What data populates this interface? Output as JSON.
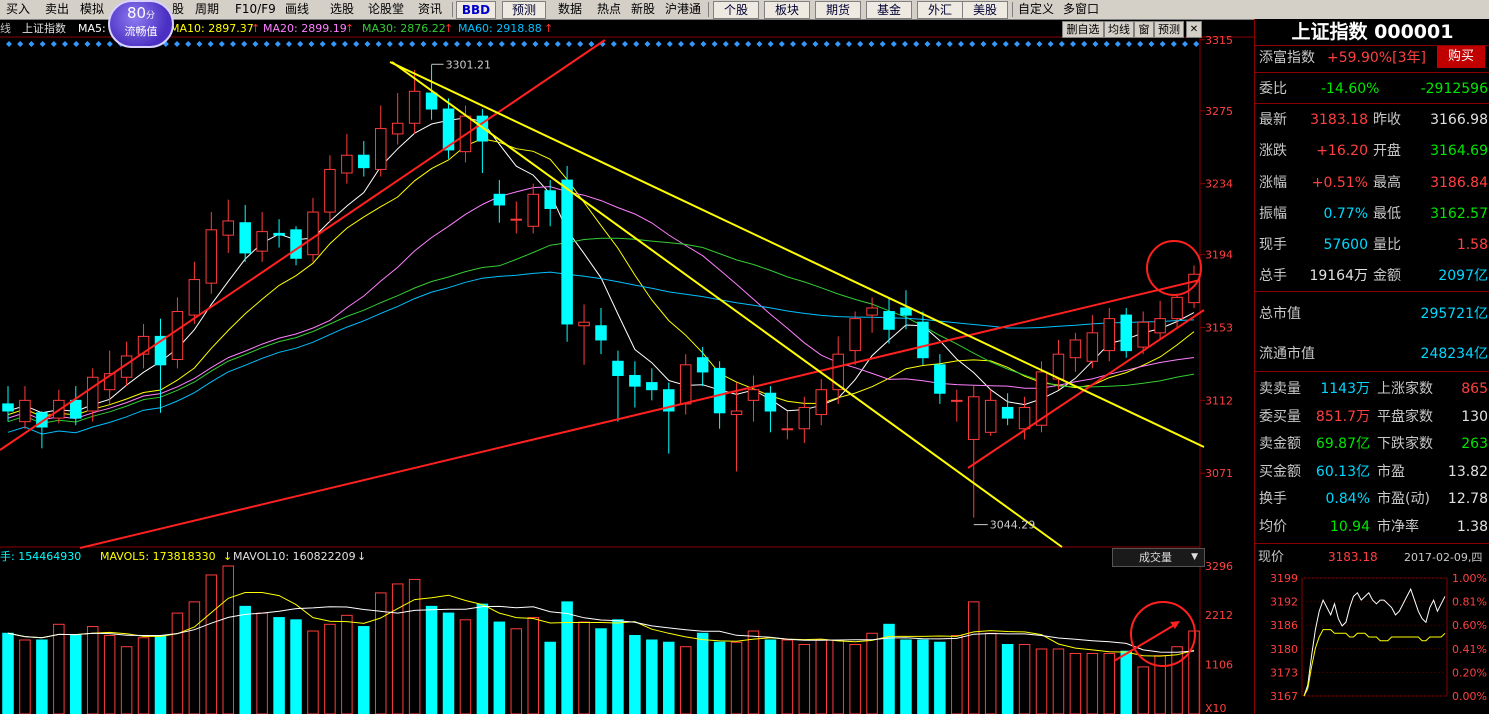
{
  "toolbar": {
    "items": [
      "买入",
      "卖出",
      "模拟",
      "",
      "股",
      "周期",
      "F10/F9",
      "画线",
      "选股",
      "论股堂",
      "资讯"
    ],
    "bbd": "BBD",
    "predict": "预测",
    "menu": [
      "数据",
      "热点",
      "新股",
      "沪港通"
    ],
    "buttons": [
      "个股",
      "板块",
      "期货",
      "基金",
      "外汇",
      "美股"
    ],
    "right": [
      "自定义",
      "多窗口"
    ]
  },
  "perf_badge": {
    "value": "80",
    "unit": "分",
    "label": "流畅值"
  },
  "ma_bar": {
    "prefix": "线",
    "name": "上证指数",
    "ma5": "MA5: 2",
    "ma10": "MA10: 2897.37",
    "ma20": "MA20: 2899.19",
    "ma30": "MA30: 2876.22",
    "ma60": "MA60: 2918.88",
    "arrow": "↑",
    "buttons": [
      "删自选",
      "均线",
      "窗",
      "预测"
    ]
  },
  "colors": {
    "up": "#ff3b3b",
    "down": "#00ffff",
    "ma5": "#ffffff",
    "ma10": "#ffff00",
    "ma20": "#ff7fff",
    "ma30": "#33cc33",
    "ma60": "#00c0ff",
    "axis": "#8b0000",
    "trend_red": "#ff2020",
    "trend_yellow": "#ffff00"
  },
  "chart_data": {
    "type": "candlestick",
    "y_ticks": [
      "3315",
      "3275",
      "3234",
      "3194",
      "3153",
      "3112",
      "3071"
    ],
    "ylim": [
      3030,
      3316
    ],
    "annotations": {
      "high": "3301.21",
      "low": "3044.29",
      "high_value": 3301.21,
      "low_value": 3044.29
    },
    "candles": [
      [
        3110,
        3106,
        3120,
        3100
      ],
      [
        3100,
        3112,
        3120,
        3096
      ],
      [
        3105,
        3097,
        3106,
        3085
      ],
      [
        3102,
        3112,
        3118,
        3099
      ],
      [
        3112,
        3102,
        3120,
        3098
      ],
      [
        3106,
        3125,
        3130,
        3100
      ],
      [
        3118,
        3127,
        3140,
        3110
      ],
      [
        3125,
        3137,
        3145,
        3120
      ],
      [
        3138,
        3148,
        3155,
        3130
      ],
      [
        3148,
        3132,
        3158,
        3105
      ],
      [
        3135,
        3162,
        3170,
        3130
      ],
      [
        3160,
        3180,
        3190,
        3155
      ],
      [
        3178,
        3208,
        3218,
        3172
      ],
      [
        3205,
        3213,
        3225,
        3195
      ],
      [
        3212,
        3195,
        3222,
        3190
      ],
      [
        3196,
        3207,
        3218,
        3190
      ],
      [
        3206,
        3205,
        3214,
        3198
      ],
      [
        3208,
        3192,
        3210,
        3188
      ],
      [
        3194,
        3218,
        3226,
        3190
      ],
      [
        3218,
        3242,
        3250,
        3212
      ],
      [
        3240,
        3250,
        3262,
        3234
      ],
      [
        3250,
        3243,
        3258,
        3238
      ],
      [
        3242,
        3265,
        3278,
        3238
      ],
      [
        3262,
        3268,
        3285,
        3256
      ],
      [
        3268,
        3286,
        3298,
        3262
      ],
      [
        3285,
        3276,
        3301,
        3270
      ],
      [
        3276,
        3253,
        3282,
        3248
      ],
      [
        3252,
        3272,
        3278,
        3246
      ],
      [
        3272,
        3258,
        3276,
        3240
      ],
      [
        3228,
        3222,
        3236,
        3212
      ],
      [
        3214,
        3214,
        3224,
        3206
      ],
      [
        3210,
        3228,
        3234,
        3206
      ],
      [
        3230,
        3220,
        3236,
        3210
      ],
      [
        3236,
        3155,
        3244,
        3145
      ],
      [
        3154,
        3156,
        3166,
        3132
      ],
      [
        3154,
        3146,
        3164,
        3138
      ],
      [
        3134,
        3126,
        3140,
        3100
      ],
      [
        3126,
        3120,
        3134,
        3108
      ],
      [
        3122,
        3118,
        3130,
        3112
      ],
      [
        3118,
        3106,
        3122,
        3082
      ],
      [
        3110,
        3132,
        3138,
        3104
      ],
      [
        3136,
        3128,
        3142,
        3120
      ],
      [
        3130,
        3105,
        3134,
        3096
      ],
      [
        3104,
        3106,
        3122,
        3072
      ],
      [
        3112,
        3118,
        3126,
        3100
      ],
      [
        3116,
        3106,
        3120,
        3094
      ],
      [
        3096,
        3096,
        3106,
        3090
      ],
      [
        3096,
        3108,
        3114,
        3088
      ],
      [
        3104,
        3118,
        3124,
        3098
      ],
      [
        3118,
        3138,
        3148,
        3110
      ],
      [
        3140,
        3158,
        3162,
        3132
      ],
      [
        3160,
        3164,
        3170,
        3150
      ],
      [
        3162,
        3152,
        3170,
        3144
      ],
      [
        3164,
        3160,
        3174,
        3152
      ],
      [
        3156,
        3136,
        3162,
        3132
      ],
      [
        3132,
        3116,
        3138,
        3110
      ],
      [
        3112,
        3112,
        3118,
        3100
      ],
      [
        3090,
        3114,
        3120,
        3046
      ],
      [
        3094,
        3112,
        3118,
        3092
      ],
      [
        3108,
        3102,
        3116,
        3098
      ],
      [
        3096,
        3108,
        3114,
        3090
      ],
      [
        3098,
        3128,
        3134,
        3094
      ],
      [
        3124,
        3138,
        3146,
        3118
      ],
      [
        3136,
        3146,
        3150,
        3128
      ],
      [
        3134,
        3150,
        3160,
        3130
      ],
      [
        3140,
        3158,
        3164,
        3134
      ],
      [
        3160,
        3140,
        3164,
        3136
      ],
      [
        3142,
        3156,
        3162,
        3138
      ],
      [
        3150,
        3158,
        3168,
        3146
      ],
      [
        3158,
        3170,
        3172,
        3152
      ],
      [
        3167,
        3183,
        3188,
        3164
      ]
    ],
    "volume": {
      "y_ticks": [
        "3296",
        "2212",
        "1106",
        "X10"
      ],
      "ylim": [
        0,
        3300
      ],
      "labels": {
        "v1": "手: 154464930",
        "v2": "MAVOL5: 173818330",
        "v3": "MAVOL10: 160822209",
        "arrow": "↓"
      },
      "dropdown": "成交量",
      "values": [
        1800,
        1650,
        1650,
        2000,
        1750,
        1950,
        1750,
        1500,
        1700,
        1750,
        2250,
        2500,
        3100,
        3300,
        2400,
        2250,
        2150,
        2100,
        1850,
        2000,
        2200,
        1950,
        2700,
        2900,
        3000,
        2400,
        2250,
        2100,
        2450,
        2050,
        1900,
        2150,
        1600,
        2500,
        2050,
        1900,
        2100,
        1750,
        1650,
        1600,
        1500,
        1800,
        1600,
        1600,
        1850,
        1650,
        1650,
        1550,
        1650,
        1650,
        1550,
        1800,
        2000,
        1650,
        1650,
        1600,
        1750,
        2500,
        1800,
        1550,
        1550,
        1450,
        1450,
        1350,
        1350,
        1350,
        1400,
        1050,
        1300,
        1500,
        1850
      ]
    },
    "ma_series": [
      "MA5",
      "MA10",
      "MA20",
      "MA30",
      "MA60"
    ]
  },
  "panel": {
    "title": "上证指数 000001",
    "rows": [
      {
        "l": "添富指数",
        "v": "+59.90%[3年]",
        "btn": "购买"
      },
      {
        "l": "委比",
        "v": "-14.60%",
        "v2": "-2912596"
      },
      {
        "l": "最新",
        "v": "3183.18",
        "l2": "昨收",
        "v2": "3166.98"
      },
      {
        "l": "涨跌",
        "v": "+16.20",
        "l2": "开盘",
        "v2": "3164.69"
      },
      {
        "l": "涨幅",
        "v": "+0.51%",
        "l2": "最高",
        "v2": "3186.84"
      },
      {
        "l": "振幅",
        "v": "0.77%",
        "l2": "最低",
        "v2": "3162.57"
      },
      {
        "l": "现手",
        "v": "57600",
        "l2": "量比",
        "v2": "1.58"
      },
      {
        "l": "总手",
        "v": "19164万",
        "l2": "金额",
        "v2": "2097亿"
      },
      {
        "l": "总市值",
        "v2": "295721亿"
      },
      {
        "l": "流通市值",
        "v2": "248234亿"
      },
      {
        "l": "卖卖量",
        "v": "1143万",
        "l2": "上涨家数",
        "v2": "865"
      },
      {
        "l": "委买量",
        "v": "851.7万",
        "l2": "平盘家数",
        "v2": "130"
      },
      {
        "l": "卖金额",
        "v": "69.87亿",
        "l2": "下跌家数",
        "v2": "263"
      },
      {
        "l": "买金额",
        "v": "60.13亿",
        "l2": "市盈",
        "v2": "13.82"
      },
      {
        "l": "换手",
        "v": "0.84%",
        "l2": "市盈(动)",
        "v2": "12.78"
      },
      {
        "l": "均价",
        "v": "10.94",
        "l2": "市净率",
        "v2": "1.38"
      }
    ],
    "mini": {
      "price_label": "现价",
      "price": "3183.18",
      "date": "2017-02-09,四",
      "left_ticks": [
        "3199",
        "3192",
        "3186",
        "3180",
        "3173",
        "3167"
      ],
      "right_ticks": [
        "1.00%",
        "0.81%",
        "0.60%",
        "0.41%",
        "0.20%",
        "0.00%"
      ],
      "ylim": [
        3167,
        3199
      ],
      "price_series": [
        3167,
        3170,
        3178,
        3185,
        3190,
        3193,
        3191,
        3189,
        3192,
        3188,
        3186,
        3187,
        3191,
        3194,
        3195,
        3193,
        3194,
        3195,
        3193,
        3192,
        3193,
        3193,
        3192,
        3191,
        3189,
        3190,
        3192,
        3194,
        3196,
        3193,
        3190,
        3188,
        3187,
        3191,
        3193,
        3190,
        3192,
        3194
      ],
      "avg_series": [
        3167,
        3169,
        3175,
        3180,
        3183,
        3185,
        3185,
        3185,
        3184,
        3184,
        3184,
        3184,
        3183,
        3183,
        3184,
        3184,
        3184,
        3183,
        3183,
        3183,
        3182,
        3182,
        3182,
        3183,
        3183,
        3183,
        3183,
        3183,
        3183,
        3183,
        3183,
        3182,
        3182,
        3183,
        3183,
        3183,
        3183,
        3184
      ]
    }
  }
}
